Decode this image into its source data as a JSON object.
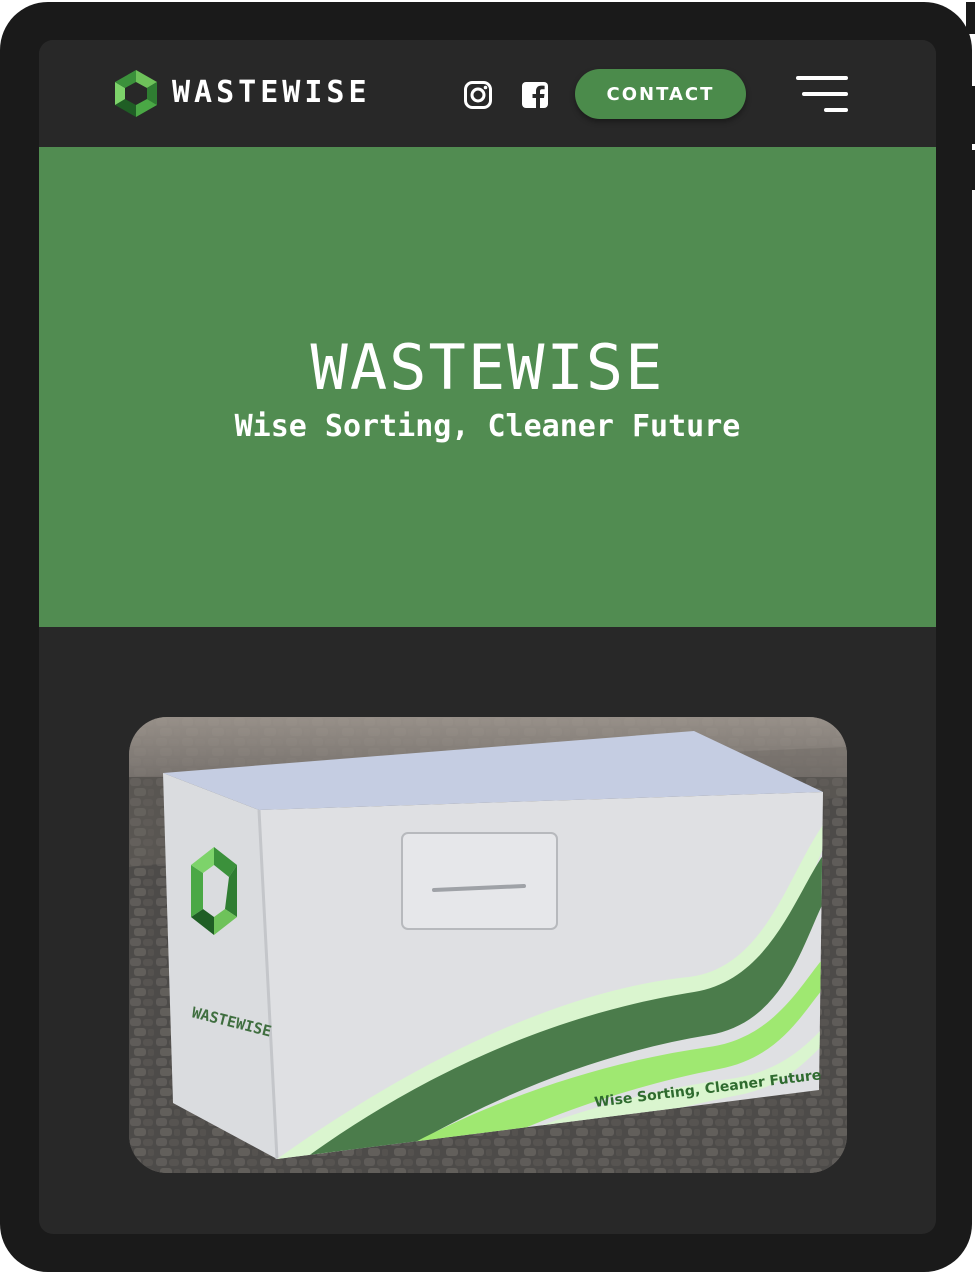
{
  "header": {
    "brand": "WASTEWISE",
    "contact_label": "CONTACT",
    "social": [
      "instagram-icon",
      "facebook-icon"
    ],
    "menu_icon": "hamburger-menu-icon"
  },
  "hero": {
    "title": "WASTEWISE",
    "subtitle": "Wise Sorting, Cleaner Future"
  },
  "product_image": {
    "box_brand": "WASTEWISE",
    "box_slogan": "Wise Sorting, Cleaner Future"
  },
  "colors": {
    "accent": "#518c51",
    "button": "#4b8b4b",
    "background": "#282828",
    "device_frame": "#1a1a1a"
  }
}
